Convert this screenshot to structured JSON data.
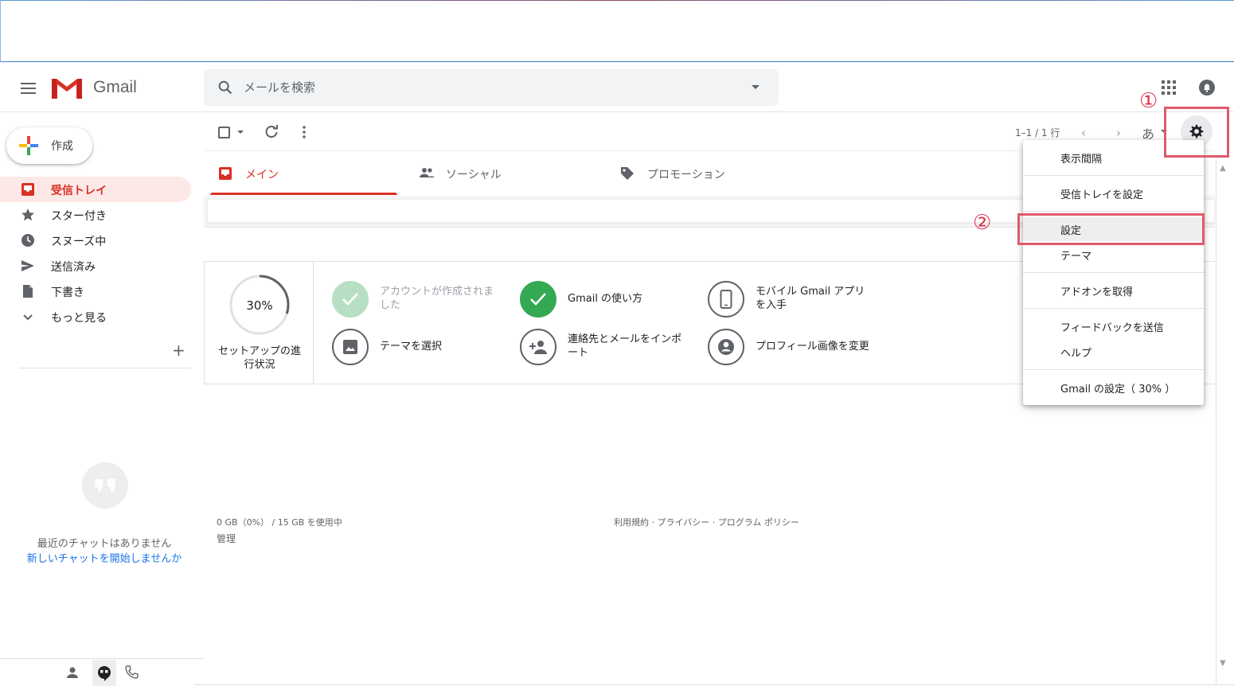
{
  "app": {
    "name": "Gmail"
  },
  "search": {
    "placeholder": "メールを検索"
  },
  "compose": {
    "label": "作成"
  },
  "nav": {
    "items": [
      {
        "label": "受信トレイ",
        "icon": "inbox-icon",
        "active": true
      },
      {
        "label": "スター付き",
        "icon": "star-icon"
      },
      {
        "label": "スヌーズ中",
        "icon": "clock-icon"
      },
      {
        "label": "送信済み",
        "icon": "send-icon"
      },
      {
        "label": "下書き",
        "icon": "draft-icon"
      },
      {
        "label": "もっと見る",
        "icon": "chevron-down-icon"
      }
    ],
    "labels_add": "+"
  },
  "chat": {
    "empty": "最近のチャットはありません",
    "start": "新しいチャットを開始しませんか"
  },
  "toolbar": {
    "pager": "1–1 / 1 行",
    "ime": "あ"
  },
  "tabs": [
    {
      "label": "メイン",
      "icon": "inbox-icon",
      "active": true
    },
    {
      "label": "ソーシャル",
      "icon": "people-icon"
    },
    {
      "label": "プロモーション",
      "icon": "tag-icon"
    }
  ],
  "setup": {
    "progress_pct": "30%",
    "progress_value": 0.3,
    "progress_label": "セットアップの進行状況",
    "tasks": [
      {
        "label": "アカウントが作成されました",
        "status": "done-faded"
      },
      {
        "label": "Gmail の使い方",
        "status": "done"
      },
      {
        "label": "モバイル Gmail アプリを入手",
        "status": "todo",
        "icon": "phone-icon"
      },
      {
        "label": "テーマを選択",
        "status": "todo",
        "icon": "image-icon"
      },
      {
        "label": "連絡先とメールをインポート",
        "status": "todo",
        "icon": "add-person-icon"
      },
      {
        "label": "プロフィール画像を変更",
        "status": "todo",
        "icon": "account-icon"
      }
    ]
  },
  "footer": {
    "storage": "0 GB（0%） / 15 GB を使用中",
    "manage": "管理",
    "terms": "利用規約 · プライバシー · プログラム ポリシー"
  },
  "settings_menu": {
    "items": [
      "表示間隔",
      "受信トレイを設定",
      "設定",
      "テーマ",
      "アドオンを取得",
      "フィードバックを送信",
      "ヘルプ",
      "Gmail の設定（ 30% ）"
    ]
  },
  "annotations": {
    "step1": "①",
    "step2": "②",
    "color": "#e05a6a"
  },
  "colors": {
    "accent": "#d93025",
    "success": "#34a853",
    "link": "#1a73e8"
  }
}
